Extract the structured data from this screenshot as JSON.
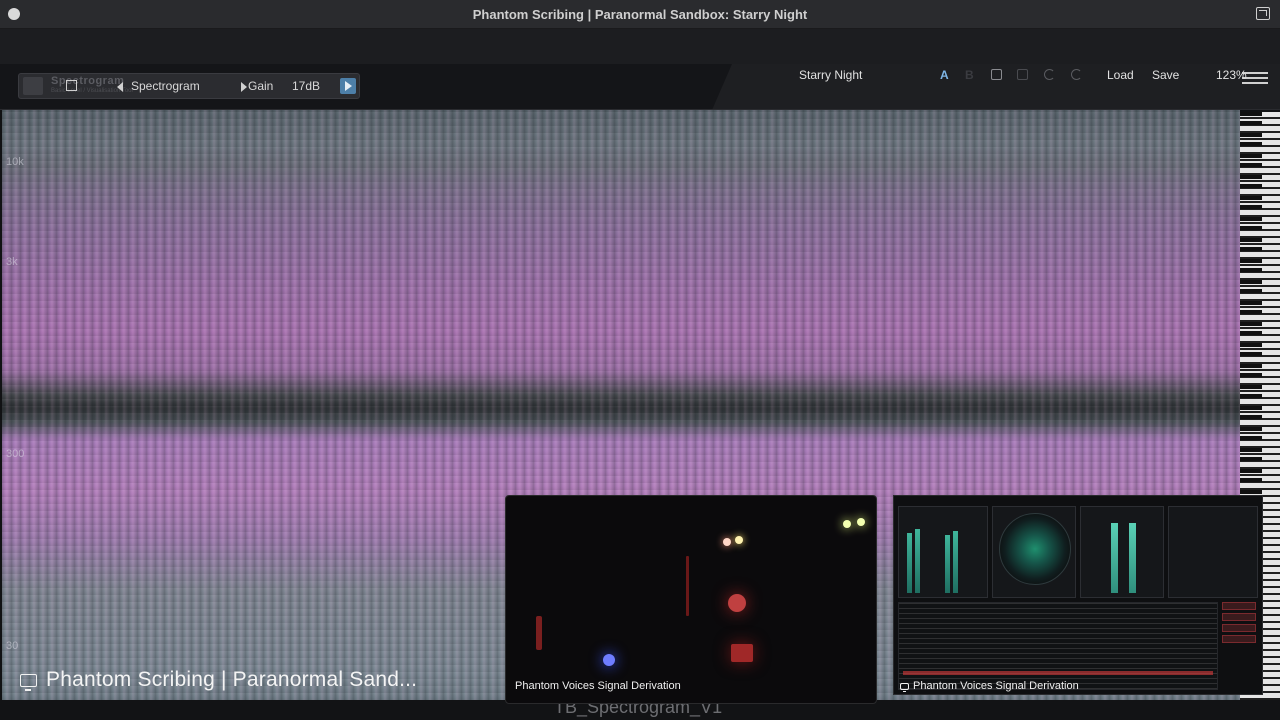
{
  "window": {
    "title": "Phantom Scribing | Paranormal Sandbox: Starry Night"
  },
  "toolbar": {
    "logo_text": "Spectrogram",
    "logo_subtext": "Basic Level / Visualisation Tool",
    "view_label": "Spectrogram",
    "gain_label": "Gain",
    "gain_value": "17dB"
  },
  "header": {
    "preset_name": "Starry Night",
    "ab_a": "A",
    "ab_b": "B",
    "load_label": "Load",
    "save_label": "Save",
    "zoom": "123%"
  },
  "spectrogram": {
    "freq_labels": [
      "10k",
      "3k",
      "300",
      "30"
    ]
  },
  "thumbnails": {
    "main_caption": "Phantom Scribing | Paranormal Sand...",
    "camera_caption": "Phantom Voices Signal Derivation",
    "meters_caption": "Phantom Voices Signal Derivation",
    "ghost_label": "TB_Spectrogram_V1"
  },
  "colors": {
    "accent": "#4d7fa8",
    "ab_active": "#7fb6e6",
    "spectro_pink": "#b07dba",
    "spectro_gray": "#6f7e88"
  }
}
